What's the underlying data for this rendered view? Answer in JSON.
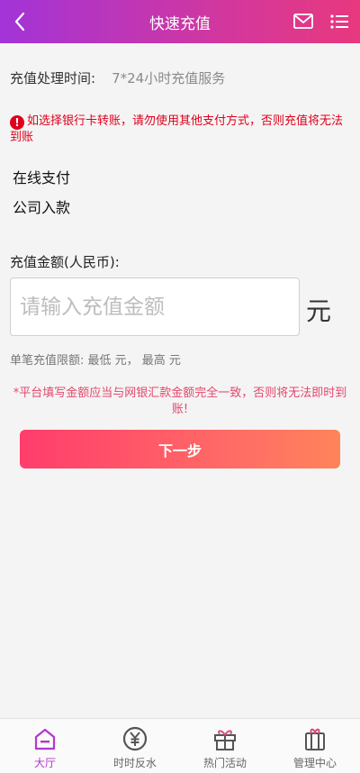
{
  "header": {
    "title": "快速充值",
    "back_icon": "chevron-left-icon",
    "mail_icon": "mail-icon",
    "menu_icon": "list-menu-icon"
  },
  "processing": {
    "label": "充值处理时间:",
    "value": "7*24小时充值服务"
  },
  "warning": {
    "icon": "alert-icon",
    "text": "如选择银行卡转账，请勿使用其他支付方式，否则充值将无法到账"
  },
  "methods": [
    "在线支付",
    "公司入款"
  ],
  "amount": {
    "label": "充值金额(人民币):",
    "placeholder": "请输入充值金额",
    "value": "",
    "unit": "元"
  },
  "limits": {
    "text": "单笔充值限额:  最低 元，  最高 元"
  },
  "notice": "*平台填写金额应当与网银汇款金额完全一致，否则将无法即时到账!",
  "next_button": "下一步",
  "colors": {
    "header_start": "#a234d8",
    "header_end": "#e8387e",
    "warning": "#e0001b",
    "notice": "#e4476d",
    "button_start": "#ff3d6c",
    "button_end": "#ff8459",
    "active_tab": "#b436d0"
  },
  "tabs": [
    {
      "label": "大厅",
      "icon": "home-icon",
      "active": true
    },
    {
      "label": "时时反水",
      "icon": "yuan-coin-icon",
      "active": false
    },
    {
      "label": "热门活动",
      "icon": "gift-icon",
      "active": false
    },
    {
      "label": "管理中心",
      "icon": "gift-box-icon",
      "active": false
    }
  ]
}
